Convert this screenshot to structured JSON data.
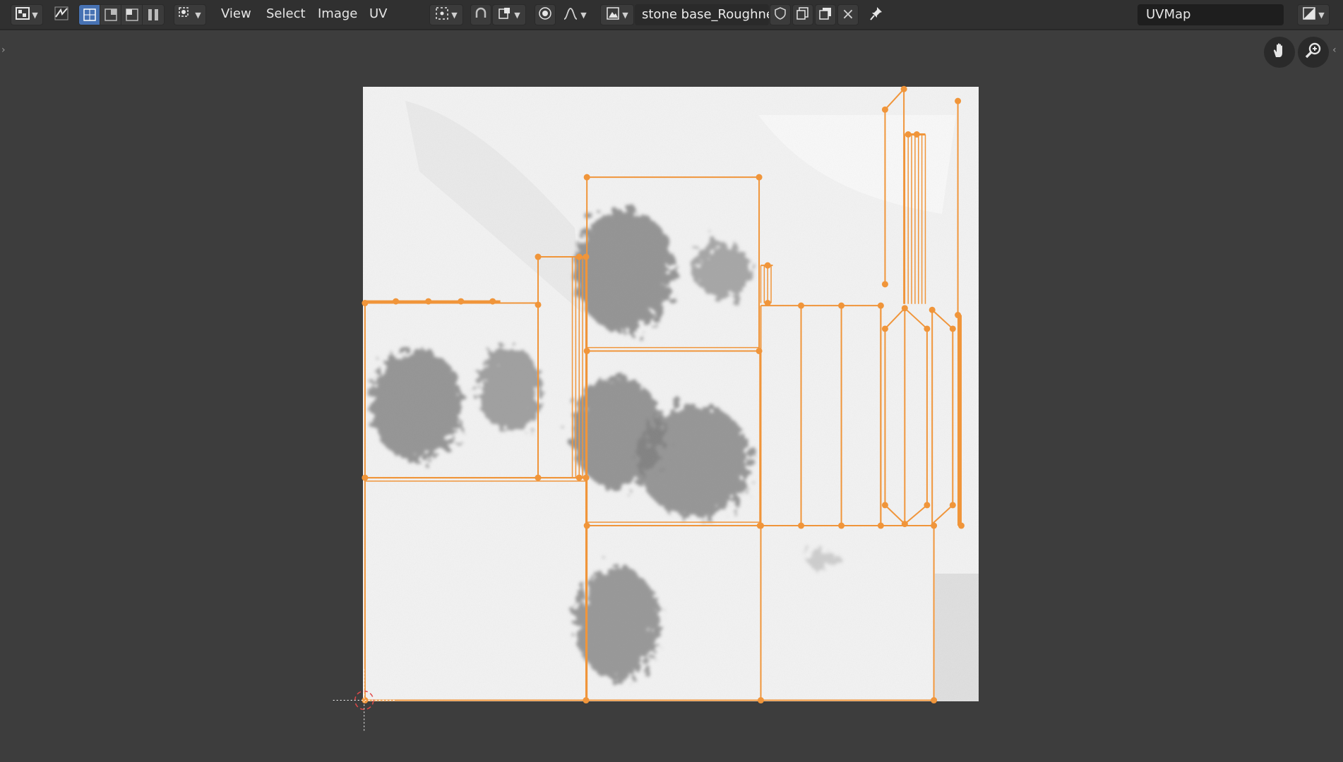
{
  "header": {
    "editor_type_icon": "image-editor-icon",
    "sync_selection_icon": "uv-sync-selection-icon",
    "select_mode_icons": [
      "uv-vertex-select-icon",
      "uv-edge-select-icon",
      "uv-face-select-icon",
      "uv-island-select-icon"
    ],
    "sticky_mode_icon": "sticky-selection-icon",
    "menus": {
      "view": "View",
      "select": "Select",
      "image": "Image",
      "uv": "UV"
    },
    "pivot_icon": "pivot-point-icon",
    "snap_icon": "snap-icon",
    "snap_target_icon": "snap-target-icon",
    "proportional_icon": "proportional-editing-icon",
    "falloff_icon": "falloff-curve-icon",
    "browse_image_icon": "browse-image-icon",
    "image_name": "stone base_Roughne..",
    "fake_user_icon": "fake-user-shield-icon",
    "new_image_icon": "new-image-icon",
    "open_image_icon": "open-image-icon",
    "unlink_icon": "close-icon",
    "pin_icon": "pin-icon",
    "uv_map": "UVMap",
    "display_channels_icon": "display-channels-icon"
  },
  "viewport": {
    "navigation": {
      "pan_icon": "hand-pan-icon",
      "zoom_icon": "zoom-icon"
    },
    "colors": {
      "uv_edge": "#f0953a",
      "background": "#3d3d3d",
      "header": "#303030",
      "active_button": "#4772b3"
    }
  }
}
